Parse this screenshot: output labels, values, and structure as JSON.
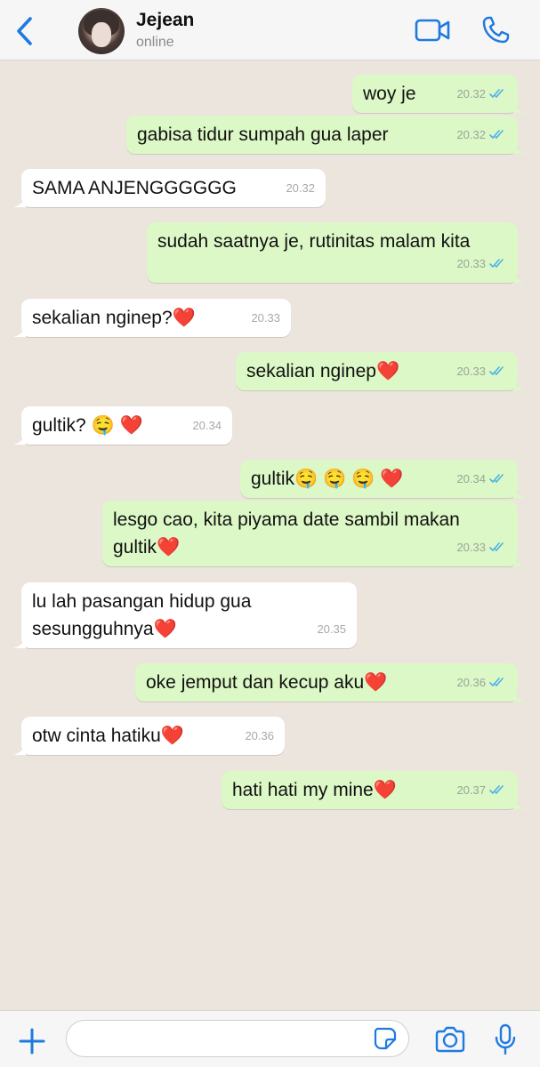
{
  "header": {
    "contact_name": "Jejean",
    "status": "online"
  },
  "messages": [
    {
      "dir": "out",
      "text": "woy je",
      "time": "20.32"
    },
    {
      "dir": "out",
      "text": "gabisa tidur sumpah gua laper",
      "time": "20.32"
    },
    {
      "dir": "in",
      "text": "SAMA ANJENGGGGGG",
      "time": "20.32"
    },
    {
      "dir": "out",
      "text": "sudah saatnya je, rutinitas malam kita",
      "time": "20.33"
    },
    {
      "dir": "in",
      "text": "sekalian nginep?❤️",
      "time": "20.33"
    },
    {
      "dir": "out",
      "text": "sekalian nginep❤️",
      "time": "20.33"
    },
    {
      "dir": "in",
      "text": "gultik? 🤤 ❤️",
      "time": "20.34"
    },
    {
      "dir": "out",
      "text": "gultik🤤 🤤 🤤 ❤️",
      "time": "20.34"
    },
    {
      "dir": "out",
      "text": "lesgo cao, kita piyama date sambil makan\ngultik❤️",
      "time": "20.33"
    },
    {
      "dir": "in",
      "text": "lu lah pasangan hidup gua\nsesungguhnya❤️",
      "time": "20.35"
    },
    {
      "dir": "out",
      "text": "oke jemput dan kecup aku❤️",
      "time": "20.36"
    },
    {
      "dir": "in",
      "text": "otw cinta hatiku❤️",
      "time": "20.36"
    },
    {
      "dir": "out",
      "text": "hati hati my mine❤️",
      "time": "20.37"
    }
  ],
  "input": {
    "value": "",
    "placeholder": ""
  },
  "colors": {
    "background": "#ECE5DD",
    "outgoing_bubble": "#DCF8C6",
    "incoming_bubble": "#FFFFFF",
    "accent_blue": "#1F7AE0",
    "read_ticks": "#4FB0E8"
  },
  "icons": [
    "back-chevron-icon",
    "video-camera-icon",
    "phone-icon",
    "plus-icon",
    "sticker-icon",
    "camera-icon",
    "microphone-icon",
    "double-check-icon"
  ]
}
